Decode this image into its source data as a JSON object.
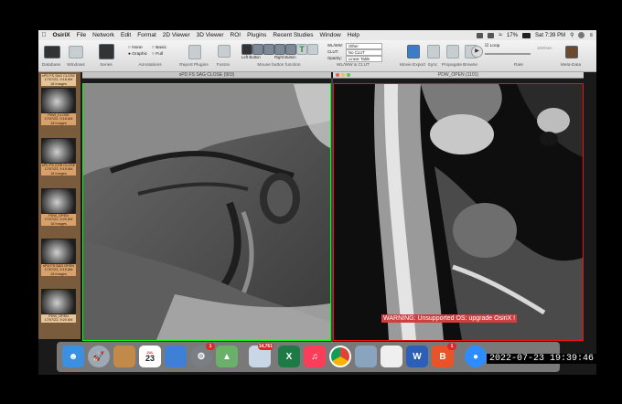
{
  "menubar": {
    "app": "OsiriX",
    "items": [
      "File",
      "Network",
      "Edit",
      "Format",
      "2D Viewer",
      "3D Viewer",
      "ROI",
      "Plugins",
      "Recent Studies",
      "Window",
      "Help"
    ],
    "battery": "17%",
    "clock": "Sat 7:39 PM"
  },
  "toolbar": {
    "labels": [
      "Database",
      "Windows",
      "Series",
      "Annotations",
      "Report Plugins",
      "Fusion",
      "Mouse button function",
      "WL/WW & CLUT",
      "Movie Export",
      "Sync",
      "Propagate",
      "Browse",
      "Rate",
      "Meta-Data"
    ],
    "annot_none": "None",
    "annot_graphic": "Graphic",
    "annot_basic": "Basic",
    "annot_full": "Full",
    "left_button": "Left Button",
    "right_button": "Right Button",
    "wlww_label": "WL/WW:",
    "clut_label": "CLUT:",
    "opacity_label": "Opacity:",
    "wlww_value": "Other",
    "clut_value": "No CLUT",
    "opacity_value": "Linear Table",
    "loop": "Loop",
    "rate_value": "100/sec"
  },
  "series": [
    {
      "label": "sPD FS SAG CLOSE\n17/07/22, 9:18 AM\n18 Images",
      "selected": true
    },
    {
      "label": "PDW_CLOSE\n17/07/22, 9:18 AM\n18 Images",
      "selected": false
    },
    {
      "label": "sPD FS COR CLOSE\n17/07/22, 9:19 AM\n18 Images",
      "selected": false
    },
    {
      "label": "PDW_OPEN\n17/07/22, 9:20 AM\n18 Images",
      "selected": false
    },
    {
      "label": "sPD FS SAG OPEN\n17/07/22, 9:19 AM\n18 Images",
      "selected": false
    },
    {
      "label": "PDW_OPEN\n17/07/22, 9:20 AM",
      "selected": true
    }
  ],
  "viewer_left": {
    "title": "sPD FS SAG CLOSE (903)"
  },
  "viewer_right": {
    "title": "PDW_OPEN (1101)",
    "warning": "WARNING: Unsupported OS: upgrade OsiriX !"
  },
  "dock": {
    "calendar_month": "JUL",
    "calendar_day": "23",
    "badges": {
      "sysprefs": "1",
      "photos": "14,761",
      "brave": "1"
    }
  },
  "timestamp": "2022-07-23  19:39:46"
}
